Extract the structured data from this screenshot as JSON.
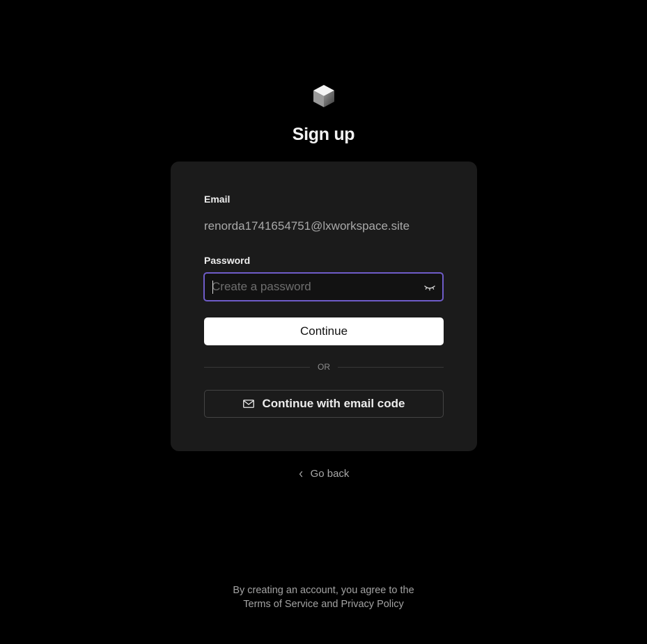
{
  "header": {
    "logo_icon": "cube-logo-icon",
    "title": "Sign up"
  },
  "form": {
    "email_label": "Email",
    "email_value": "renorda1741654751@lxworkspace.site",
    "password_label": "Password",
    "password_placeholder": "Create a password",
    "password_value": "",
    "password_toggle_icon": "eye-closed-icon",
    "continue_label": "Continue",
    "divider_text": "OR",
    "email_code_icon": "mail-icon",
    "email_code_label": "Continue with email code"
  },
  "nav": {
    "back_icon": "chevron-left-icon",
    "back_label": "Go back"
  },
  "footer": {
    "line1": "By creating an account, you agree to the",
    "terms_label": "Terms of Service",
    "and_text": "and",
    "privacy_label": "Privacy Policy"
  },
  "colors": {
    "background": "#000000",
    "card": "#1b1b1b",
    "focus_accent": "#6f5cc9",
    "primary_button": "#ffffff"
  }
}
